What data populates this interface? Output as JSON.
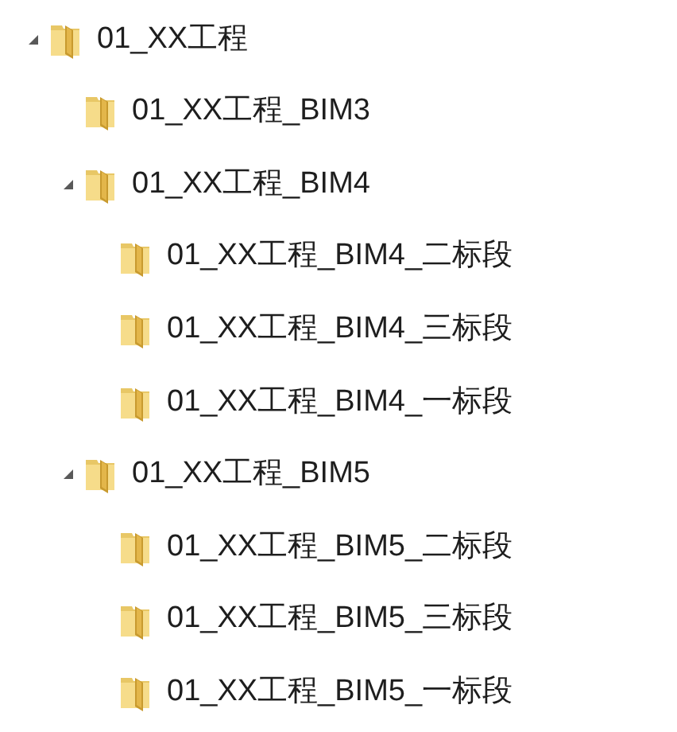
{
  "tree": [
    {
      "label": "01_XX工程",
      "expanded": true,
      "children": [
        {
          "label": "01_XX工程_BIM3",
          "expanded": false
        },
        {
          "label": "01_XX工程_BIM4",
          "expanded": true,
          "children": [
            {
              "label": "01_XX工程_BIM4_二标段",
              "expanded": false
            },
            {
              "label": "01_XX工程_BIM4_三标段",
              "expanded": false
            },
            {
              "label": "01_XX工程_BIM4_一标段",
              "expanded": false
            }
          ]
        },
        {
          "label": "01_XX工程_BIM5",
          "expanded": true,
          "children": [
            {
              "label": "01_XX工程_BIM5_二标段",
              "expanded": false
            },
            {
              "label": "01_XX工程_BIM5_三标段",
              "expanded": false
            },
            {
              "label": "01_XX工程_BIM5_一标段",
              "expanded": false
            }
          ]
        }
      ]
    }
  ]
}
